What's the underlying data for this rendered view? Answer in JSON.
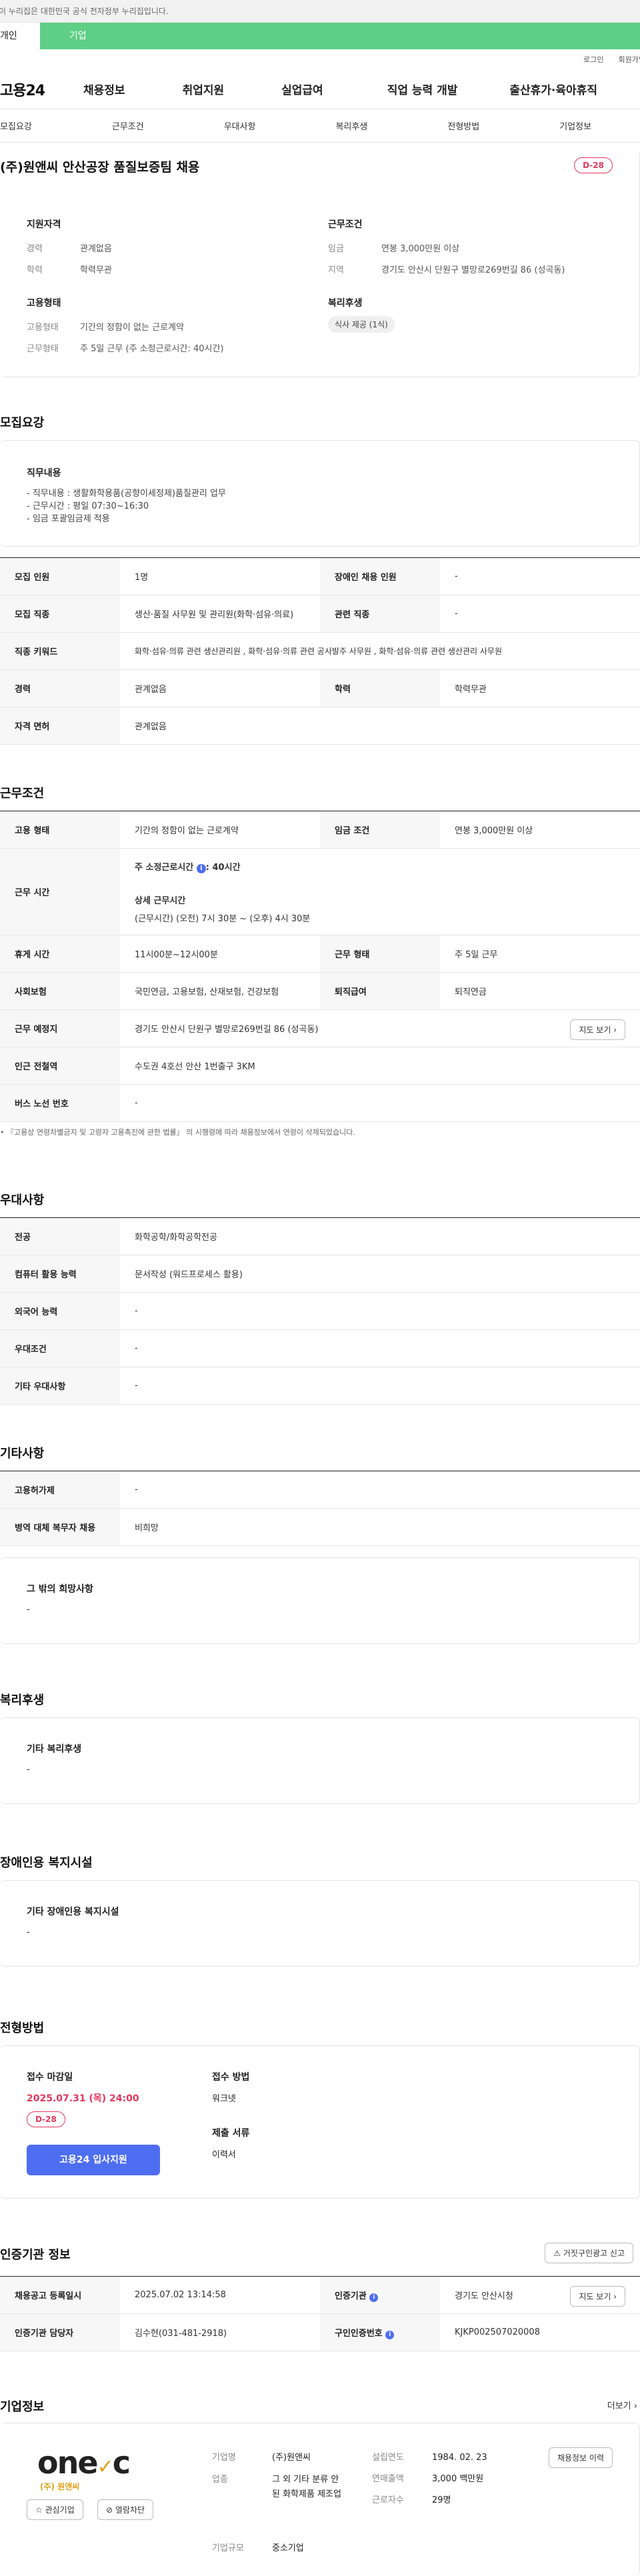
{
  "gov_notice": "이 누리집은 대한민국 공식 전자정부 누리집입니다.",
  "user_tabs": {
    "individual": "개인",
    "corporate": "기업"
  },
  "util": {
    "login": "로그인",
    "signup": "회원가입"
  },
  "logo": "고용24",
  "gnb": [
    "채용정보",
    "취업지원",
    "실업급여",
    "직업 능력 개발",
    "출산휴가·육아휴직"
  ],
  "tabs": [
    "모집요강",
    "근무조건",
    "우대사항",
    "복리후생",
    "전형방법",
    "기업정보"
  ],
  "header": {
    "title": "(주)원앤씨 안산공장 품질보증팀 채용",
    "dday": "D-28",
    "qual_title": "지원자격",
    "qual": [
      {
        "k": "경력",
        "v": "관계없음"
      },
      {
        "k": "학력",
        "v": "학력무관"
      }
    ],
    "emp_title": "고용형태",
    "emp": [
      {
        "k": "고용형태",
        "v": "기간의 정함이 없는 근로계약"
      },
      {
        "k": "근무형태",
        "v": "주 5일 근무 (주 소정근로시간: 40시간)"
      }
    ],
    "cond_title": "근무조건",
    "cond": [
      {
        "k": "임금",
        "v": "연봉 3,000만원 이상"
      },
      {
        "k": "지역",
        "v": "경기도 안산시 단원구 별망로269번길 86 (성곡동)"
      }
    ],
    "welfare_title": "복리후생",
    "welfare_tag": "식사 제공 (1식)"
  },
  "recruit": {
    "title": "모집요강",
    "box_title": "직무내용",
    "lines": [
      "- 직무내용 : 생활화학용품(공향이세정제)품질관리 업무",
      "- 근무시간 : 평일 07:30~16:30",
      "- 임금 포괄임금제 적용"
    ],
    "rows": [
      {
        "k": "모집 인원",
        "v": "1명",
        "k2": "장애인 채용 인원",
        "v2": "-"
      },
      {
        "k": "모집 직종",
        "v": "생산·품질 사무원 및 관리원(화학·섬유·의료)",
        "k2": "관련 직종",
        "v2": "-"
      },
      {
        "k": "직종 키워드",
        "v": "화학·섬유·의류 관련 생산관리원 , 화학·섬유·의류 관련 공사발주 사무원 , 화학·섬유·의류 관련 생산관리 사무원"
      },
      {
        "k": "경력",
        "v": "관계없음",
        "k2": "학력",
        "v2": "학력무관"
      },
      {
        "k": "자격 면허",
        "v": "관계없음"
      }
    ]
  },
  "work": {
    "title": "근무조건",
    "emp_k": "고용 형태",
    "emp_v": "기간의 정함이 없는 근로계약",
    "wage_k": "임금 조건",
    "wage_v": "연봉 3,000만원 이상",
    "time_k": "근무 시간",
    "week_hours": "주 소정근로시간",
    "week_hours_v": "40시간",
    "detail_k": "상세 근무시간",
    "detail_v": "(근무시간) (오전) 7시 30분 ~ (오후) 4시 30분",
    "rest_k": "휴게 시간",
    "rest_v": "11시00분~12시00분",
    "type_k": "근무 형태",
    "type_v": "주 5일 근무",
    "ins_k": "사회보험",
    "ins_v": "국민연금, 고용보험, 산재보험, 건강보험",
    "ret_k": "퇴직급여",
    "ret_v": "퇴직연금",
    "place_k": "근무 예정지",
    "place_v": "경기도 안산시 단원구 별망로269번길 86 (성곡동)",
    "map_btn": "지도 보기",
    "subway_k": "인근 전철역",
    "subway_v": "수도권 4호선 안산 1번출구 3KM",
    "bus_k": "버스 노선 번호",
    "bus_v": "-",
    "note": "『고용상 연령차별금지 및 고령자 고용촉진에 관한 법률』 의 시행령에 따라 채용정보에서 연령이 삭제되었습니다."
  },
  "pref": {
    "title": "우대사항",
    "rows": [
      {
        "k": "전공",
        "v": "화학공학/화학공학전공"
      },
      {
        "k": "컴퓨터 활용 능력",
        "v": "문서작성 (워드프로세스 활용)"
      },
      {
        "k": "외국어 능력",
        "v": "-"
      },
      {
        "k": "우대조건",
        "v": "-"
      },
      {
        "k": "기타 우대사항",
        "v": "-"
      }
    ]
  },
  "etc": {
    "title": "기타사항",
    "rows": [
      {
        "k": "고용허가제",
        "v": "-"
      },
      {
        "k": "병역 대체 복무자 채용",
        "v": "비희망"
      }
    ],
    "box_title": "그 밖의 희망사항",
    "box_v": "-"
  },
  "welfare": {
    "title": "복리후생",
    "box_title": "기타 복리후생",
    "box_v": "-"
  },
  "disabled": {
    "title": "장애인용 복지시설",
    "box_title": "기타 장애인용 복지시설",
    "box_v": "-"
  },
  "screening": {
    "title": "전형방법",
    "deadline_k": "접수 마감일",
    "deadline_v": "2025.07.31 (목) 24:00",
    "dday": "D-28",
    "apply_btn": "고용24 입사지원",
    "method_k": "접수 방법",
    "method_v": "워크넷",
    "docs_k": "제출 서류",
    "docs_v": "이력서"
  },
  "cert": {
    "title": "인증기관 정보",
    "report_btn": "거짓구인광고 신고",
    "reg_k": "채용공고 등록일시",
    "reg_v": "2025.07.02 13:14:58",
    "agency_k": "인증기관",
    "agency_v": "경기도 안산시청",
    "map_btn": "지도 보기",
    "manager_k": "인증기관 담당자",
    "manager_v": "김수현(031-481-2918)",
    "certno_k": "구인인증번호",
    "certno_v": "KJKP002507020008"
  },
  "company": {
    "title": "기업정보",
    "more": "더보기",
    "logo_text": "one",
    "logo_c": "c",
    "logo_sub": "(주) 원앤씨",
    "fav_btn": "관심기업",
    "block_btn": "열람차단",
    "name_k": "기업명",
    "name_v": "(주)원앤씨",
    "industry_k": "업종",
    "industry_v": "그 외 기타 분류 안된 화학제품 제조업",
    "size_k": "기업규모",
    "size_v": "중소기업",
    "founded_k": "설립연도",
    "founded_v": "1984. 02. 23",
    "sales_k": "연매출액",
    "sales_v": "3,000 백만원",
    "emp_k": "근로자수",
    "emp_v": "29명",
    "jobs_btn": "채용정보 이력"
  },
  "colors": {
    "accent": "#e2375d",
    "brand_green": "#5fcf86",
    "primary": "#4e6ef2"
  }
}
